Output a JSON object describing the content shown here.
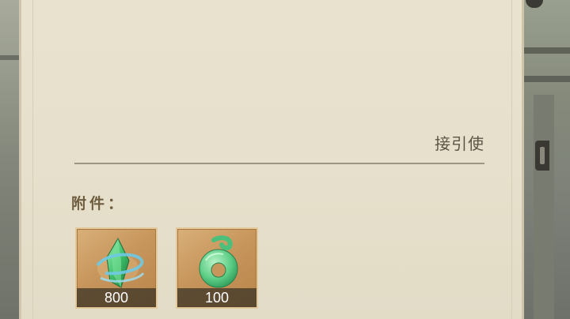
{
  "letter": {
    "signature": "接引使",
    "attachments_label": "附件："
  },
  "attachments": [
    {
      "icon": "green-crystal-icon",
      "quantity": "800"
    },
    {
      "icon": "jade-ring-icon",
      "quantity": "100"
    }
  ],
  "colors": {
    "paper": "#e6e0cc",
    "slot_gold": "#c7965c",
    "text": "#5b5446",
    "label": "#6e5e3f"
  }
}
